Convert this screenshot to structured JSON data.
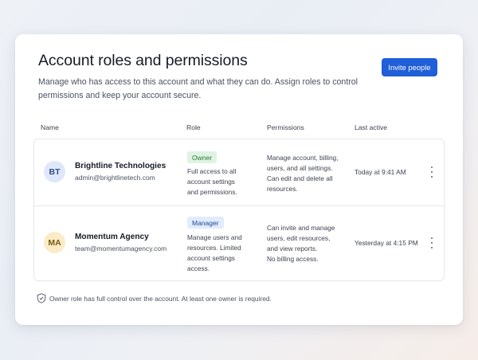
{
  "header": {
    "title": "Account roles and permissions",
    "subtitle": "Manage who has access to this account and what they can do. Assign roles to control permissions and keep your account secure.",
    "invite_label": "Invite people",
    "accent_color": "#1f5fd8"
  },
  "table": {
    "columns": [
      "Name",
      "Role",
      "Permissions",
      "Last active"
    ],
    "rows": [
      {
        "initials": "BT",
        "name": "Brightline Technologies",
        "email": "admin@brightlinetech.com",
        "role": "Owner",
        "role_desc": [
          "Full access to all",
          "account settings",
          "and permissions."
        ],
        "permissions": [
          "Manage account, billing,",
          "users, and all settings.",
          "Can edit and delete all",
          "resources."
        ],
        "last_active": "Today at 9:41 AM",
        "menu_icon": "more-vertical-icon"
      },
      {
        "initials": "MA",
        "name": "Momentum Agency",
        "email": "team@momentumagency.com",
        "role": "Manager",
        "role_desc": [
          "Manage users and",
          "resources. Limited",
          "account settings",
          "access."
        ],
        "permissions": [
          "Can invite and manage",
          "users, edit resources,",
          "and view reports.",
          "No billing access."
        ],
        "last_active": "Yesterday at 4:15 PM",
        "menu_icon": "more-vertical-icon"
      }
    ]
  },
  "footer": {
    "icon": "shield-icon",
    "note": "Owner role has full control over the account. At least one owner is required."
  }
}
